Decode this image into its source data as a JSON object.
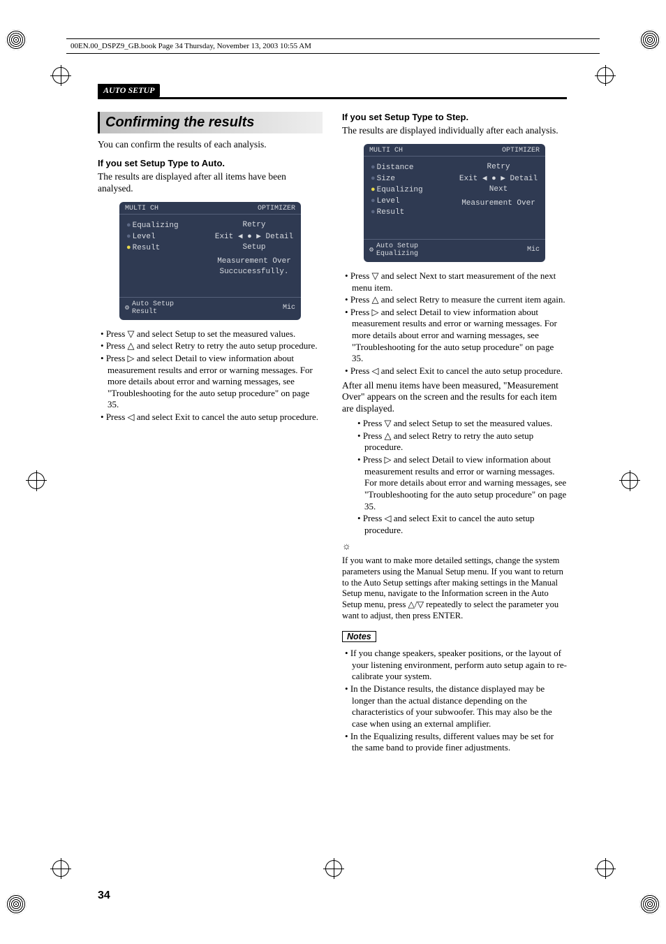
{
  "running_header": "00EN.00_DSPZ9_GB.book  Page 34  Thursday, November 13, 2003  10:55 AM",
  "section_tab": "AUTO SETUP",
  "page_number": "34",
  "left": {
    "heading": "Confirming the results",
    "intro": "You can confirm the results of each analysis.",
    "subhead": "If you set Setup Type to Auto.",
    "subtext": "The results are displayed after all items have been analysed.",
    "osd": {
      "title_left": "MULTI CH",
      "title_right": "OPTIMIZER",
      "rows": [
        {
          "label": "Equalizing",
          "state": "inactive"
        },
        {
          "label": "Level",
          "state": "inactive"
        },
        {
          "label": "Result",
          "state": "active"
        }
      ],
      "right_lines": [
        "Retry",
        "Exit ◀ ● ▶ Detail",
        "Setup",
        "Measurement Over",
        "Succucessfully."
      ],
      "footer_title1": "Auto Setup",
      "footer_title2": "Result",
      "footer_right": "Mic"
    },
    "bullets": [
      "Press ▽ and select Setup to set the measured values.",
      "Press △ and select Retry to retry the auto setup procedure.",
      "Press ▷ and select Detail to view information about measurement results and error or warning messages. For more details about error and warning messages, see \"Troubleshooting for the auto setup procedure\" on page 35.",
      "Press ◁ and select Exit to cancel the auto setup procedure."
    ]
  },
  "right": {
    "subhead": "If you set Setup Type to Step.",
    "subtext": "The results are displayed individually after each analysis.",
    "osd": {
      "title_left": "MULTI CH",
      "title_right": "OPTIMIZER",
      "rows": [
        {
          "label": "Distance",
          "state": "inactive"
        },
        {
          "label": "Size",
          "state": "inactive"
        },
        {
          "label": "Equalizing",
          "state": "active"
        },
        {
          "label": "Level",
          "state": "inactive"
        },
        {
          "label": "Result",
          "state": "inactive"
        }
      ],
      "right_lines": [
        "Retry",
        "Exit ◀ ● ▶ Detail",
        "Next",
        "Measurement Over"
      ],
      "footer_title1": "Auto Setup",
      "footer_title2": "Equalizing",
      "footer_right": "Mic"
    },
    "bullets1": [
      "Press ▽ and select Next to start measurement of the next menu item.",
      "Press △ and select Retry to measure the current item again.",
      "Press ▷ and select Detail to view information about measurement results and error or warning messages. For more details about error and warning messages, see \"Troubleshooting for the auto setup procedure\" on page 35.",
      "Press ◁ and select Exit to cancel the auto setup procedure."
    ],
    "para2": "After all menu items have been measured, \"Measurement Over\" appears on the screen and the results for each item are displayed.",
    "bullets2": [
      "Press ▽ and select Setup to set the measured values.",
      "Press △ and select Retry to retry the auto setup procedure.",
      "Press ▷ and select Detail to view information about measurement results and error or warning messages. For more details about error and warning messages, see \"Troubleshooting for the auto setup procedure\" on page 35.",
      "Press ◁ and select Exit to cancel the auto setup procedure."
    ],
    "tip_icon": "☼",
    "tip_text": "If you want to make more detailed settings, change the system parameters using the Manual Setup menu. If you want to return to the Auto Setup settings after making settings in the Manual Setup menu, navigate to the Information screen in the Auto Setup menu, press △/▽ repeatedly to select the parameter you want to adjust, then press ENTER.",
    "notes_label": "Notes",
    "notes": [
      "If you change speakers, speaker positions, or the layout of your listening environment, perform auto setup again to re-calibrate your system.",
      "In the Distance results, the distance displayed may be longer than the actual distance depending on the characteristics of your subwoofer. This may also be the case when using an external amplifier.",
      "In the Equalizing results, different values may be set for the same band to provide finer adjustments."
    ]
  }
}
